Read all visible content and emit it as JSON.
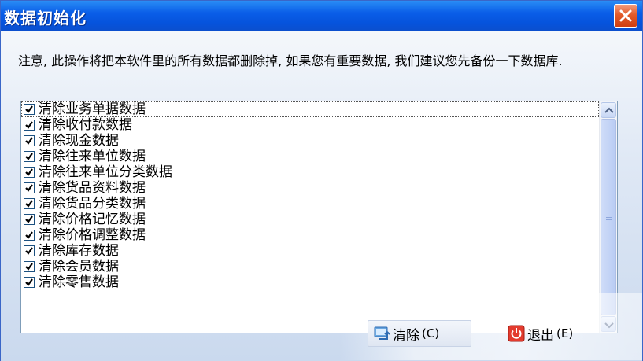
{
  "window": {
    "title": "数据初始化",
    "close_icon": "close-icon"
  },
  "notice": "注意, 此操作将把本软件里的所有数据都删除掉, 如果您有重要数据, 我们建议您先备份一下数据库.",
  "items": [
    {
      "label": "清除业务单据数据",
      "checked": true
    },
    {
      "label": "清除收付款数据",
      "checked": true
    },
    {
      "label": "清除现金数据",
      "checked": true
    },
    {
      "label": "清除往来单位数据",
      "checked": true
    },
    {
      "label": "清除往来单位分类数据",
      "checked": true
    },
    {
      "label": "清除货品资料数据",
      "checked": true
    },
    {
      "label": "清除货品分类数据",
      "checked": true
    },
    {
      "label": "清除价格记忆数据",
      "checked": true
    },
    {
      "label": "清除价格调整数据",
      "checked": true
    },
    {
      "label": "清除库存数据",
      "checked": true
    },
    {
      "label": "清除会员数据",
      "checked": true
    },
    {
      "label": "清除零售数据",
      "checked": true
    }
  ],
  "buttons": {
    "clear": {
      "label": "清除",
      "shortcut": "(C)",
      "icon": "clear-icon"
    },
    "exit": {
      "label": "退出",
      "shortcut": "(E)",
      "icon": "power-icon"
    }
  },
  "colors": {
    "titlebar": "#0653dc",
    "close": "#e25b2b",
    "check": "#1c5180"
  }
}
